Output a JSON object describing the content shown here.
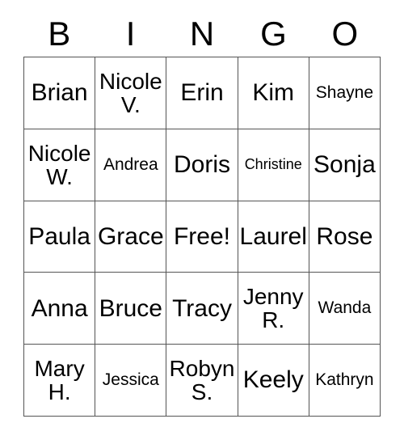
{
  "card": {
    "type": "bingo-card",
    "headers": [
      "B",
      "I",
      "N",
      "G",
      "O"
    ],
    "columns": 5,
    "rows": 5,
    "free_space": {
      "row": 3,
      "column": 3,
      "label": "Free!"
    },
    "colors": {
      "background": "#ffffff",
      "text": "#000000",
      "grid_line": "#555555"
    },
    "grid": [
      [
        {
          "name": "Brian",
          "lines": [
            "Brian"
          ],
          "size": "fs-xl"
        },
        {
          "name": "Nicole V.",
          "lines": [
            "Nicole",
            "V."
          ],
          "size": "fs-lg"
        },
        {
          "name": "Erin",
          "lines": [
            "Erin"
          ],
          "size": "fs-xl"
        },
        {
          "name": "Kim",
          "lines": [
            "Kim"
          ],
          "size": "fs-xl"
        },
        {
          "name": "Shayne",
          "lines": [
            "Shayne"
          ],
          "size": "fs-md"
        }
      ],
      [
        {
          "name": "Nicole W.",
          "lines": [
            "Nicole",
            "W."
          ],
          "size": "fs-lg"
        },
        {
          "name": "Andrea",
          "lines": [
            "Andrea"
          ],
          "size": "fs-md"
        },
        {
          "name": "Doris",
          "lines": [
            "Doris"
          ],
          "size": "fs-xl"
        },
        {
          "name": "Christine",
          "lines": [
            "Christine"
          ],
          "size": "fs-sm"
        },
        {
          "name": "Sonja",
          "lines": [
            "Sonja"
          ],
          "size": "fs-xl"
        }
      ],
      [
        {
          "name": "Paula",
          "lines": [
            "Paula"
          ],
          "size": "fs-xl"
        },
        {
          "name": "Grace",
          "lines": [
            "Grace"
          ],
          "size": "fs-xl"
        },
        {
          "name": "Free!",
          "lines": [
            "Free!"
          ],
          "size": "fs-xl"
        },
        {
          "name": "Laurel",
          "lines": [
            "Laurel"
          ],
          "size": "fs-xl"
        },
        {
          "name": "Rose",
          "lines": [
            "Rose"
          ],
          "size": "fs-xl"
        }
      ],
      [
        {
          "name": "Anna",
          "lines": [
            "Anna"
          ],
          "size": "fs-xl"
        },
        {
          "name": "Bruce",
          "lines": [
            "Bruce"
          ],
          "size": "fs-xl"
        },
        {
          "name": "Tracy",
          "lines": [
            "Tracy"
          ],
          "size": "fs-xl"
        },
        {
          "name": "Jenny R.",
          "lines": [
            "Jenny",
            "R."
          ],
          "size": "fs-lg"
        },
        {
          "name": "Wanda",
          "lines": [
            "Wanda"
          ],
          "size": "fs-md"
        }
      ],
      [
        {
          "name": "Mary H.",
          "lines": [
            "Mary",
            "H."
          ],
          "size": "fs-lg"
        },
        {
          "name": "Jessica",
          "lines": [
            "Jessica"
          ],
          "size": "fs-md"
        },
        {
          "name": "Robyn S.",
          "lines": [
            "Robyn",
            "S."
          ],
          "size": "fs-lg"
        },
        {
          "name": "Keely",
          "lines": [
            "Keely"
          ],
          "size": "fs-xl"
        },
        {
          "name": "Kathryn",
          "lines": [
            "Kathryn"
          ],
          "size": "fs-md"
        }
      ]
    ]
  }
}
